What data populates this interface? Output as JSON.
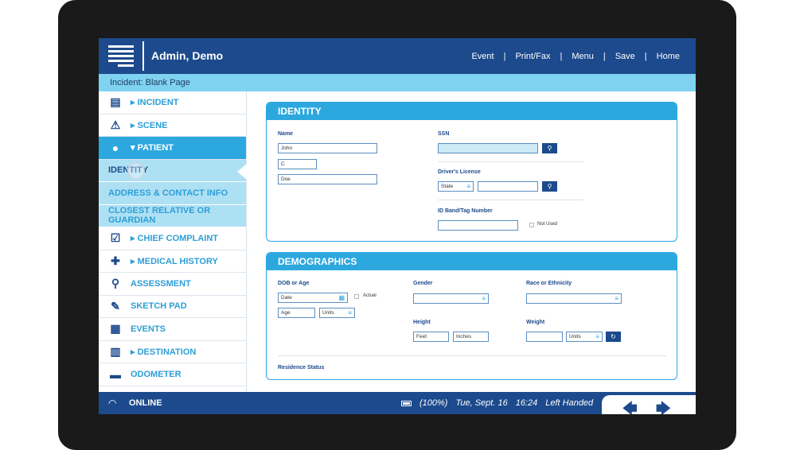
{
  "header": {
    "user": "Admin, Demo",
    "nav": [
      "Event",
      "Print/Fax",
      "Menu",
      "Save",
      "Home"
    ],
    "incident": "Incident: Blank Page"
  },
  "sidebar": {
    "items": [
      {
        "label": "▸ INCIDENT",
        "icon": "clipboard-icon"
      },
      {
        "label": "▸ SCENE",
        "icon": "warning-icon"
      },
      {
        "label": "▾ PATIENT",
        "icon": "person-icon"
      },
      {
        "label": "IDENTITY"
      },
      {
        "label": "ADDRESS & CONTACT INFO"
      },
      {
        "label": "CLOSEST RELATIVE OR GUARDIAN"
      },
      {
        "label": "▸ CHIEF COMPLAINT",
        "icon": "checkbox-icon"
      },
      {
        "label": "▸ MEDICAL HISTORY",
        "icon": "medical-cross-icon"
      },
      {
        "label": "ASSESSMENT",
        "icon": "magnifier-icon"
      },
      {
        "label": "SKETCH PAD",
        "icon": "pencil-icon"
      },
      {
        "label": "EVENTS",
        "icon": "calendar-icon"
      },
      {
        "label": "▸ DESTINATION",
        "icon": "hospital-icon"
      },
      {
        "label": "ODOMETER",
        "icon": "car-icon"
      }
    ]
  },
  "identity": {
    "title": "IDENTITY",
    "name_label": "Name",
    "first": "John",
    "middle": "C",
    "last": "Doe",
    "ssn_label": "SSN",
    "dl_label": "Driver's License",
    "state": "State",
    "idband_label": "ID Band/Tag Number",
    "not_used": "Not Used"
  },
  "demographics": {
    "title": "DEMOGRAPHICS",
    "dob_label": "DOB or Age",
    "date": "Date",
    "actual": "Actual",
    "age": "Age",
    "units": "Units",
    "gender_label": "Gender",
    "race_label": "Race or Ethnicity",
    "height_label": "Height",
    "feet": "Feet",
    "inches": "Inches",
    "weight_label": "Weight",
    "weight_units": "Units",
    "residence_label": "Residence Status"
  },
  "footer": {
    "online": "ONLINE",
    "battery": "(100%)",
    "date": "Tue, Sept. 16",
    "time": "16:24",
    "mode": "Left Handed"
  },
  "colors": {
    "primary": "#1c4a8c",
    "accent": "#2ca8df",
    "light": "#7fd3f0"
  }
}
